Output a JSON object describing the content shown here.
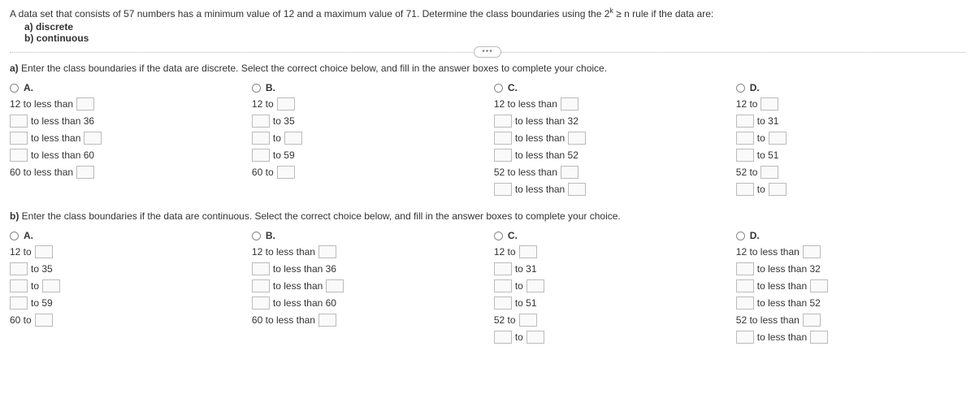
{
  "question": {
    "intro": "A data set that consists of 57 numbers has a minimum value of 12 and a maximum value of 71. Determine the class boundaries using the 2",
    "sup": "k",
    "intro_tail": " ≥ n rule if the data are:",
    "sub_a": "a) discrete",
    "sub_b": "b) continuous"
  },
  "part_a": {
    "prompt_bold": "a)",
    "prompt": " Enter the class boundaries if the data are discrete. Select the correct choice below, and fill in the answer boxes to complete your choice.",
    "A": {
      "label": "A.",
      "l1_pre": "12 to less than ",
      "l2_post": " to less than 36",
      "l3_post": " to less than ",
      "l4_post": " to less than 60",
      "l5_pre": "60 to less than "
    },
    "B": {
      "label": "B.",
      "l1_pre": "12 to ",
      "l2_post": " to 35",
      "l3_post": " to ",
      "l4_post": " to 59",
      "l5_pre": "60 to "
    },
    "C": {
      "label": "C.",
      "l1_pre": "12 to less than ",
      "l2_post": " to less than 32",
      "l3_post": " to less than ",
      "l4_post": " to less than 52",
      "l5_pre": "52 to less than ",
      "l6_post": " to less than "
    },
    "D": {
      "label": "D.",
      "l1_pre": "12 to ",
      "l2_post": " to 31",
      "l3_post": " to ",
      "l4_post": " to 51",
      "l5_pre": "52 to ",
      "l6_post": " to "
    }
  },
  "part_b": {
    "prompt_bold": "b)",
    "prompt": " Enter the class boundaries if the data are continuous. Select the correct choice below, and fill in the answer boxes to complete your choice.",
    "A": {
      "label": "A.",
      "l1_pre": "12 to ",
      "l2_post": " to 35",
      "l3_post": " to ",
      "l4_post": " to 59",
      "l5_pre": "60 to "
    },
    "B": {
      "label": "B.",
      "l1_pre": "12 to less than ",
      "l2_post": " to less than 36",
      "l3_post": " to less than ",
      "l4_post": " to less than 60",
      "l5_pre": "60 to less than "
    },
    "C": {
      "label": "C.",
      "l1_pre": "12 to ",
      "l2_post": " to 31",
      "l3_post": " to ",
      "l4_post": " to 51",
      "l5_pre": "52 to ",
      "l6_post": " to "
    },
    "D": {
      "label": "D.",
      "l1_pre": "12 to less than ",
      "l2_post": " to less than 32",
      "l3_post": " to less than ",
      "l4_post": " to less than 52",
      "l5_pre": "52 to less than ",
      "l6_post": " to less than "
    }
  }
}
